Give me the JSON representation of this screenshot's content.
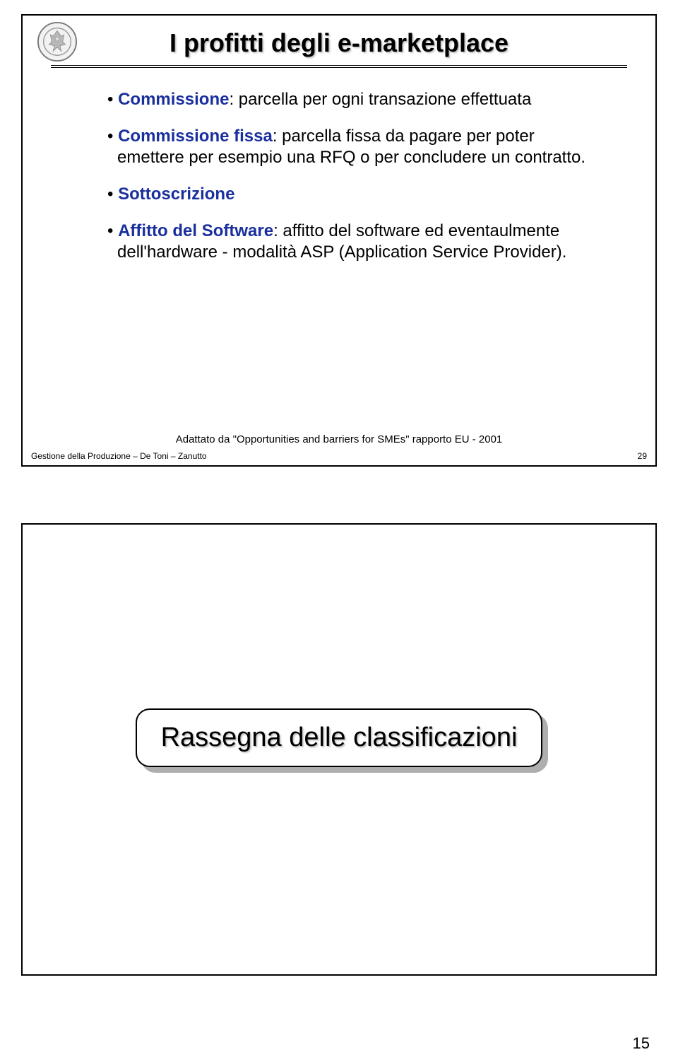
{
  "slide1": {
    "title": "I profitti degli e-marketplace",
    "bullets": {
      "b1_term": "Commissione",
      "b1_rest": ": parcella per ogni transazione effettuata",
      "b2_term": "Commissione fissa",
      "b2_rest": ": parcella fissa da pagare per poter emettere per esempio una RFQ o per concludere un contratto.",
      "b3_term": "Sottoscrizione",
      "b4_term": "Affitto del Software",
      "b4_rest": ": affitto del software ed eventaulmente dell'hardware - modalità ASP (Application Service Provider)."
    },
    "caption": "Adattato da \"Opportunities and barriers for SMEs\" rapporto EU - 2001",
    "footer_left": "Gestione della Produzione – De Toni – Zanutto",
    "footer_right": "29"
  },
  "slide2": {
    "section_title": "Rassegna delle classificazioni"
  },
  "page_number": "15"
}
